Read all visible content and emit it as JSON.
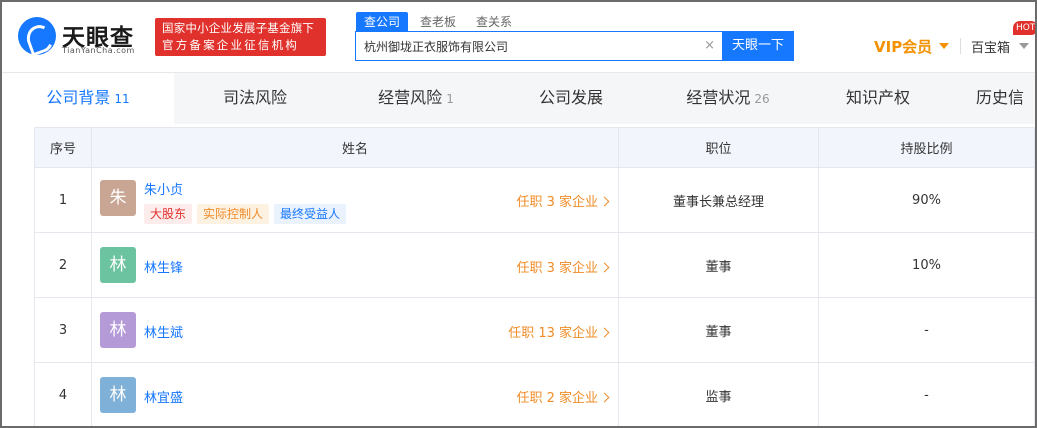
{
  "header": {
    "logo_text": "天眼查",
    "logo_sub": "TianYanCha.com",
    "badge_line1": "国家中小企业发展子基金旗下",
    "badge_line2": "官方备案企业征信机构",
    "search_tabs": [
      "查公司",
      "查老板",
      "查关系"
    ],
    "search_value": "杭州御垅正衣服饰有限公司",
    "search_clear": "×",
    "search_button": "天眼一下",
    "vip_label": "VIP会员",
    "tools_label": "百宝箱",
    "hot_badge": "HOT"
  },
  "nav": {
    "tabs": [
      {
        "label": "公司背景",
        "count": "11"
      },
      {
        "label": "司法风险",
        "count": ""
      },
      {
        "label": "经营风险",
        "count": "1"
      },
      {
        "label": "公司发展",
        "count": ""
      },
      {
        "label": "经营状况",
        "count": "26"
      },
      {
        "label": "知识产权",
        "count": ""
      },
      {
        "label": "历史信",
        "count": ""
      }
    ]
  },
  "table": {
    "headers": [
      "序号",
      "姓名",
      "职位",
      "持股比例"
    ],
    "rows": [
      {
        "index": "1",
        "avatar": "朱",
        "avatar_color": "#c9a694",
        "name": "朱小贞",
        "tags": [
          "大股东",
          "实际控制人",
          "最终受益人"
        ],
        "jobs": "任职 3 家企业",
        "position": "董事长兼总经理",
        "share": "90%"
      },
      {
        "index": "2",
        "avatar": "林",
        "avatar_color": "#6cc3a0",
        "name": "林生锋",
        "tags": [],
        "jobs": "任职 3 家企业",
        "position": "董事",
        "share": "10%"
      },
      {
        "index": "3",
        "avatar": "林",
        "avatar_color": "#b49bd8",
        "name": "林生斌",
        "tags": [],
        "jobs": "任职 13 家企业",
        "position": "董事",
        "share": "-"
      },
      {
        "index": "4",
        "avatar": "林",
        "avatar_color": "#7fb0d8",
        "name": "林宜盛",
        "tags": [],
        "jobs": "任职 2 家企业",
        "position": "监事",
        "share": "-"
      }
    ]
  }
}
